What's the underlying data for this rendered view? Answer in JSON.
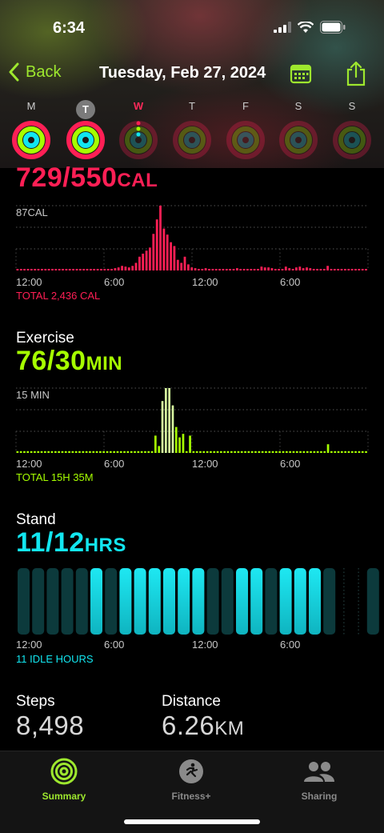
{
  "status": {
    "time": "6:34"
  },
  "nav": {
    "back_label": "Back",
    "title": "Tuesday, Feb 27, 2024"
  },
  "week": {
    "days": [
      "M",
      "T",
      "W",
      "T",
      "F",
      "S",
      "S"
    ],
    "selected_index": 1,
    "today_index": 2
  },
  "move": {
    "value": "729/550",
    "unit": "CAL",
    "max_label": "87CAL",
    "ticks": [
      "12:00",
      "6:00",
      "12:00",
      "6:00"
    ],
    "total": "TOTAL 2,436 CAL",
    "color": "#ff1f55",
    "bars": [
      2,
      2,
      2,
      2,
      2,
      2,
      2,
      2,
      2,
      2,
      2,
      2,
      2,
      2,
      2,
      2,
      2,
      2,
      2,
      2,
      2,
      2,
      2,
      2,
      2,
      2,
      2,
      2,
      3,
      4,
      6,
      5,
      4,
      6,
      10,
      18,
      22,
      26,
      30,
      48,
      67,
      85,
      55,
      47,
      37,
      32,
      14,
      10,
      18,
      8,
      4,
      3,
      2,
      2,
      3,
      2,
      2,
      2,
      2,
      2,
      2,
      2,
      2,
      3,
      2,
      2,
      2,
      2,
      2,
      2,
      5,
      4,
      4,
      3,
      2,
      2,
      2,
      5,
      3,
      2,
      4,
      5,
      3,
      4,
      3,
      2,
      2,
      2,
      2,
      6,
      2,
      2,
      2,
      2,
      2,
      2,
      2,
      2,
      2,
      2,
      2
    ]
  },
  "exercise": {
    "label": "Exercise",
    "value": "76/30",
    "unit": "MIN",
    "max_label": "15 MIN",
    "ticks": [
      "12:00",
      "6:00",
      "12:00",
      "6:00"
    ],
    "total": "TOTAL 15H 35M",
    "color": "#a6ff00",
    "bars": [
      2,
      2,
      2,
      2,
      2,
      2,
      2,
      2,
      2,
      2,
      2,
      2,
      2,
      2,
      2,
      2,
      2,
      2,
      2,
      2,
      2,
      2,
      2,
      2,
      2,
      2,
      2,
      2,
      2,
      2,
      2,
      2,
      2,
      2,
      2,
      2,
      2,
      2,
      2,
      2,
      20,
      8,
      60,
      75,
      75,
      55,
      30,
      18,
      22,
      2,
      20,
      2,
      2,
      2,
      2,
      2,
      2,
      2,
      2,
      2,
      2,
      2,
      2,
      2,
      2,
      2,
      2,
      2,
      2,
      2,
      2,
      2,
      2,
      2,
      2,
      2,
      2,
      2,
      2,
      2,
      2,
      2,
      2,
      2,
      2,
      2,
      2,
      2,
      2,
      2,
      10,
      2,
      2,
      2,
      2,
      2,
      2,
      2,
      2,
      2,
      2,
      2
    ]
  },
  "stand": {
    "label": "Stand",
    "value": "11/12",
    "unit": "HRS",
    "ticks": [
      "12:00",
      "6:00",
      "12:00",
      "6:00"
    ],
    "total": "11 IDLE HOURS",
    "color": "#12e6f0",
    "hours": [
      0,
      0,
      0,
      0,
      0,
      1,
      0,
      1,
      1,
      1,
      1,
      1,
      1,
      0,
      0,
      1,
      1,
      0,
      1,
      1,
      1,
      0,
      -1,
      -1,
      0
    ]
  },
  "steps": {
    "label": "Steps",
    "value": "8,498"
  },
  "distance": {
    "label": "Distance",
    "value": "6.26",
    "unit": "KM"
  },
  "tabs": [
    {
      "label": "Summary",
      "active": true
    },
    {
      "label": "Fitness+",
      "active": false
    },
    {
      "label": "Sharing",
      "active": false
    }
  ],
  "colors": {
    "accent": "#9ee82e",
    "move": "#ff1f55",
    "exercise": "#a6ff00",
    "stand": "#12e6f0"
  }
}
